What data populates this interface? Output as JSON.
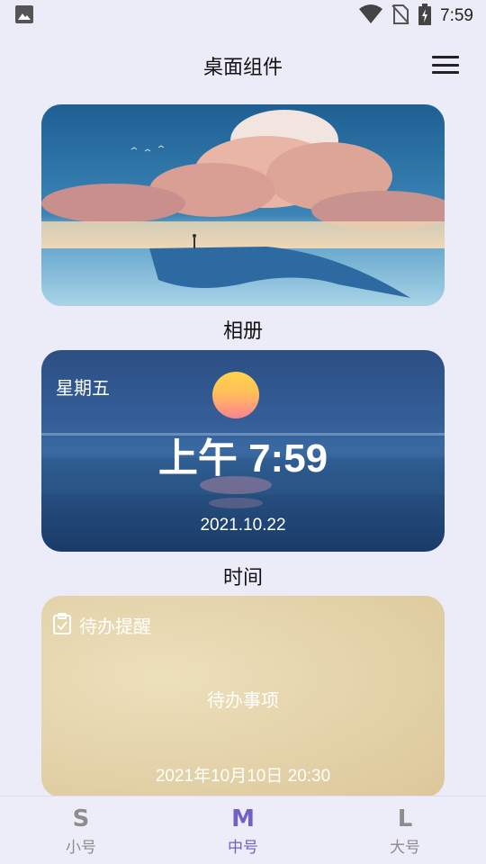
{
  "status_bar": {
    "time": "7:59",
    "icons": [
      "image-notification-icon",
      "wifi-icon",
      "no-sim-icon",
      "battery-charging-icon"
    ]
  },
  "app_bar": {
    "title": "桌面组件",
    "menu_icon": "menu-icon"
  },
  "widgets": {
    "photo": {
      "label": "相册"
    },
    "time": {
      "label": "时间",
      "weekday": "星期五",
      "clock": "上午 7:59",
      "date": "2021.10.22"
    },
    "todo": {
      "header_icon": "clipboard-check-icon",
      "title": "待办提醒",
      "item": "待办事项",
      "datetime": "2021年10月10日 20:30"
    }
  },
  "bottom_nav": {
    "items": [
      {
        "letter": "S",
        "label": "小号",
        "active": false
      },
      {
        "letter": "M",
        "label": "中号",
        "active": true
      },
      {
        "letter": "L",
        "label": "大号",
        "active": false
      }
    ]
  },
  "colors": {
    "background": "#ECEBF8",
    "accent": "#7060C8",
    "inactive": "#8D8D8D"
  }
}
